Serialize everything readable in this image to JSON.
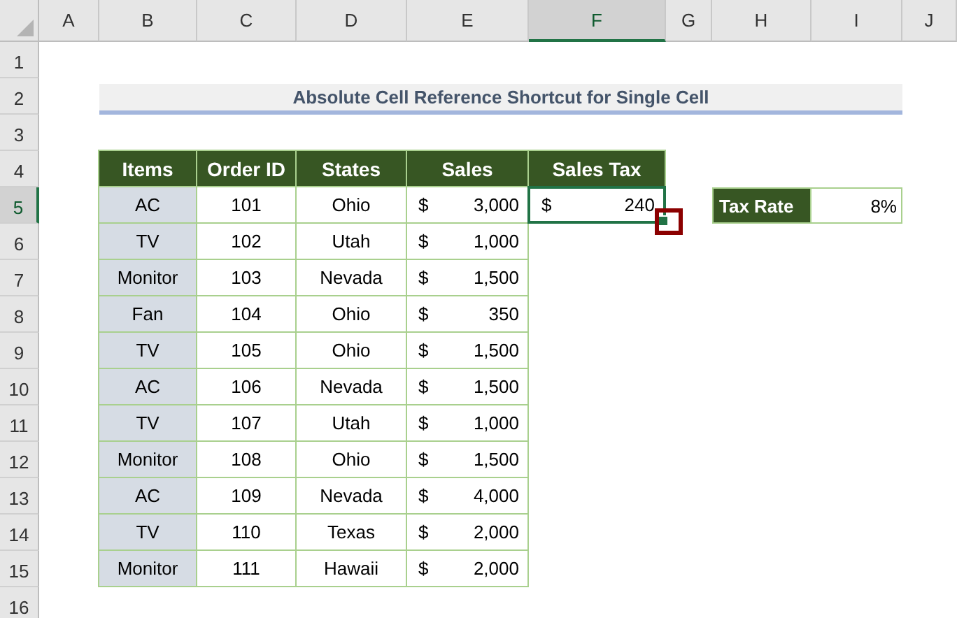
{
  "column_headers": [
    {
      "label": "A",
      "selected": false
    },
    {
      "label": "B",
      "selected": false
    },
    {
      "label": "C",
      "selected": false
    },
    {
      "label": "D",
      "selected": false
    },
    {
      "label": "E",
      "selected": false
    },
    {
      "label": "F",
      "selected": true
    },
    {
      "label": "G",
      "selected": false
    },
    {
      "label": "H",
      "selected": false
    },
    {
      "label": "I",
      "selected": false
    },
    {
      "label": "J",
      "selected": false
    }
  ],
  "row_headers": [
    {
      "label": "1",
      "selected": false
    },
    {
      "label": "2",
      "selected": false
    },
    {
      "label": "3",
      "selected": false
    },
    {
      "label": "4",
      "selected": false
    },
    {
      "label": "5",
      "selected": true
    },
    {
      "label": "6",
      "selected": false
    },
    {
      "label": "7",
      "selected": false
    },
    {
      "label": "8",
      "selected": false
    },
    {
      "label": "9",
      "selected": false
    },
    {
      "label": "10",
      "selected": false
    },
    {
      "label": "11",
      "selected": false
    },
    {
      "label": "12",
      "selected": false
    },
    {
      "label": "13",
      "selected": false
    },
    {
      "label": "14",
      "selected": false
    },
    {
      "label": "15",
      "selected": false
    },
    {
      "label": "16",
      "selected": false
    }
  ],
  "title": "Absolute Cell Reference Shortcut for Single Cell",
  "table": {
    "columns": [
      "Items",
      "Order ID",
      "States",
      "Sales",
      "Sales Tax"
    ],
    "rows": [
      {
        "item": "AC",
        "order_id": "101",
        "state": "Ohio",
        "sales": {
          "currency": "$",
          "amount": "3,000"
        },
        "sales_tax": {
          "currency": "$",
          "amount": "240",
          "selected": true
        }
      },
      {
        "item": "TV",
        "order_id": "102",
        "state": "Utah",
        "sales": {
          "currency": "$",
          "amount": "1,000"
        }
      },
      {
        "item": "Monitor",
        "order_id": "103",
        "state": "Nevada",
        "sales": {
          "currency": "$",
          "amount": "1,500"
        }
      },
      {
        "item": "Fan",
        "order_id": "104",
        "state": "Ohio",
        "sales": {
          "currency": "$",
          "amount": "350"
        }
      },
      {
        "item": "TV",
        "order_id": "105",
        "state": "Ohio",
        "sales": {
          "currency": "$",
          "amount": "1,500"
        }
      },
      {
        "item": "AC",
        "order_id": "106",
        "state": "Nevada",
        "sales": {
          "currency": "$",
          "amount": "1,500"
        }
      },
      {
        "item": "TV",
        "order_id": "107",
        "state": "Utah",
        "sales": {
          "currency": "$",
          "amount": "1,000"
        }
      },
      {
        "item": "Monitor",
        "order_id": "108",
        "state": "Ohio",
        "sales": {
          "currency": "$",
          "amount": "1,500"
        }
      },
      {
        "item": "AC",
        "order_id": "109",
        "state": "Nevada",
        "sales": {
          "currency": "$",
          "amount": "4,000"
        }
      },
      {
        "item": "TV",
        "order_id": "110",
        "state": "Texas",
        "sales": {
          "currency": "$",
          "amount": "2,000"
        }
      },
      {
        "item": "Monitor",
        "order_id": "111",
        "state": "Hawaii",
        "sales": {
          "currency": "$",
          "amount": "2,000"
        }
      }
    ]
  },
  "tax_rate": {
    "label": "Tax Rate",
    "value": "8%"
  }
}
